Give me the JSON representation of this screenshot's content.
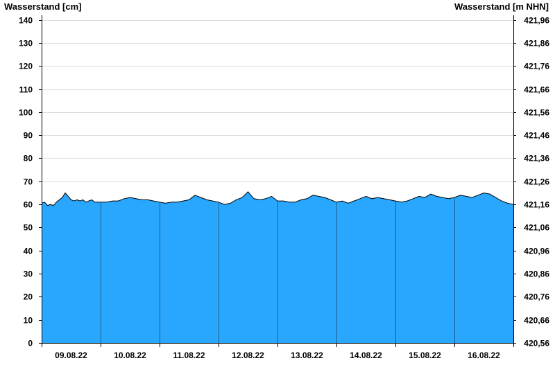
{
  "chart_data": {
    "type": "area",
    "title": "",
    "ylabel_left": "Wasserstand [cm]",
    "ylabel_right": "Wasserstand [m NHN]",
    "ylim_left": [
      0,
      143
    ],
    "left_ticks": [
      0,
      10,
      20,
      30,
      40,
      50,
      60,
      70,
      80,
      90,
      100,
      110,
      120,
      130,
      140
    ],
    "right_ticks": [
      "420,56",
      "420,66",
      "420,76",
      "420,86",
      "420,96",
      "421,06",
      "421,16",
      "421,26",
      "421,36",
      "421,46",
      "421,56",
      "421,66",
      "421,76",
      "421,86",
      "421,96"
    ],
    "x_tick_labels": [
      "09.08.22",
      "10.08.22",
      "11.08.22",
      "12.08.22",
      "13.08.22",
      "14.08.22",
      "15.08.22",
      "16.08.22"
    ],
    "xlim_days": [
      0,
      8
    ],
    "grid": true,
    "fill_color": "#29a7fe",
    "day_separator_color": "#1a5e8f",
    "series": [
      {
        "x": [
          0.0,
          0.05,
          0.1,
          0.15,
          0.2,
          0.25,
          0.3,
          0.35,
          0.4,
          0.45,
          0.5,
          0.55,
          0.6,
          0.65,
          0.7,
          0.75,
          0.8,
          0.85,
          0.9,
          0.95,
          1.0,
          1.1,
          1.2,
          1.3,
          1.4,
          1.5,
          1.6,
          1.7,
          1.8,
          1.9,
          2.0,
          2.1,
          2.2,
          2.3,
          2.4,
          2.5,
          2.6,
          2.7,
          2.8,
          2.9,
          3.0,
          3.1,
          3.2,
          3.3,
          3.4,
          3.5,
          3.6,
          3.7,
          3.8,
          3.9,
          4.0,
          4.1,
          4.2,
          4.3,
          4.4,
          4.5,
          4.6,
          4.7,
          4.8,
          4.9,
          5.0,
          5.1,
          5.2,
          5.3,
          5.4,
          5.5,
          5.6,
          5.7,
          5.8,
          5.9,
          6.0,
          6.1,
          6.2,
          6.3,
          6.4,
          6.5,
          6.6,
          6.7,
          6.8,
          6.9,
          7.0,
          7.1,
          7.2,
          7.3,
          7.4,
          7.5,
          7.6,
          7.7,
          7.8,
          7.9,
          8.0
        ],
        "values": [
          60.5,
          61,
          59.5,
          60,
          59.5,
          61,
          62,
          63,
          65,
          63.5,
          62,
          61.5,
          62,
          61.5,
          62,
          61,
          61.5,
          62,
          61,
          61,
          61,
          61,
          61.5,
          61.5,
          62.5,
          63,
          62.5,
          62,
          62,
          61.5,
          61,
          60.5,
          61,
          61,
          61.5,
          62,
          64,
          63,
          62,
          61.5,
          61,
          60,
          60.5,
          62,
          63,
          65.5,
          62.5,
          62,
          62.5,
          63.5,
          61.5,
          61.5,
          61,
          61,
          62,
          62.5,
          64,
          63.5,
          63,
          62,
          61,
          61.5,
          60.5,
          61.5,
          62.5,
          63.5,
          62.5,
          63,
          62.5,
          62,
          61.5,
          61,
          61.5,
          62.5,
          63.5,
          63,
          64.5,
          63.5,
          63,
          62.5,
          63,
          64,
          63.5,
          63,
          64,
          65,
          64.5,
          63,
          61.5,
          60.5,
          60
        ]
      }
    ]
  }
}
